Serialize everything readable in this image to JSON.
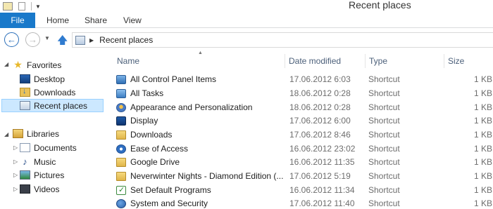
{
  "window": {
    "title": "Recent places"
  },
  "ribbon": {
    "tabs": [
      {
        "label": "File",
        "active": true
      },
      {
        "label": "Home"
      },
      {
        "label": "Share"
      },
      {
        "label": "View"
      }
    ]
  },
  "address": {
    "path": "Recent places"
  },
  "sidebar": {
    "favorites_label": "Favorites",
    "favorites": [
      {
        "label": "Desktop",
        "icon": "desktop-icon"
      },
      {
        "label": "Downloads",
        "icon": "downloads-folder-icon"
      },
      {
        "label": "Recent places",
        "icon": "recent-places-icon",
        "selected": true
      }
    ],
    "libraries_label": "Libraries",
    "libraries": [
      {
        "label": "Documents",
        "icon": "documents-icon"
      },
      {
        "label": "Music",
        "icon": "music-icon"
      },
      {
        "label": "Pictures",
        "icon": "pictures-icon"
      },
      {
        "label": "Videos",
        "icon": "videos-icon"
      }
    ]
  },
  "columns": {
    "name": "Name",
    "date": "Date modified",
    "type": "Type",
    "size": "Size"
  },
  "rows": [
    {
      "name": "All Control Panel Items",
      "date": "17.06.2012 6:03",
      "type": "Shortcut",
      "size": "1 KB",
      "icon": "control-panel-icon"
    },
    {
      "name": "All Tasks",
      "date": "18.06.2012 0:28",
      "type": "Shortcut",
      "size": "1 KB",
      "icon": "all-tasks-icon"
    },
    {
      "name": "Appearance and Personalization",
      "date": "18.06.2012 0:28",
      "type": "Shortcut",
      "size": "1 KB",
      "icon": "personalization-icon"
    },
    {
      "name": "Display",
      "date": "17.06.2012 6:00",
      "type": "Shortcut",
      "size": "1 KB",
      "icon": "display-icon"
    },
    {
      "name": "Downloads",
      "date": "17.06.2012 8:46",
      "type": "Shortcut",
      "size": "1 KB",
      "icon": "folder-icon"
    },
    {
      "name": "Ease of Access",
      "date": "16.06.2012 23:02",
      "type": "Shortcut",
      "size": "1 KB",
      "icon": "ease-of-access-icon"
    },
    {
      "name": "Google Drive",
      "date": "16.06.2012 11:35",
      "type": "Shortcut",
      "size": "1 KB",
      "icon": "folder-icon"
    },
    {
      "name": "Neverwinter Nights - Diamond Edition (...",
      "date": "17.06.2012 5:19",
      "type": "Shortcut",
      "size": "1 KB",
      "icon": "folder-icon"
    },
    {
      "name": "Set Default Programs",
      "date": "16.06.2012 11:34",
      "type": "Shortcut",
      "size": "1 KB",
      "icon": "default-programs-icon"
    },
    {
      "name": "System and Security",
      "date": "17.06.2012 11:40",
      "type": "Shortcut",
      "size": "1 KB",
      "icon": "system-security-icon"
    }
  ]
}
